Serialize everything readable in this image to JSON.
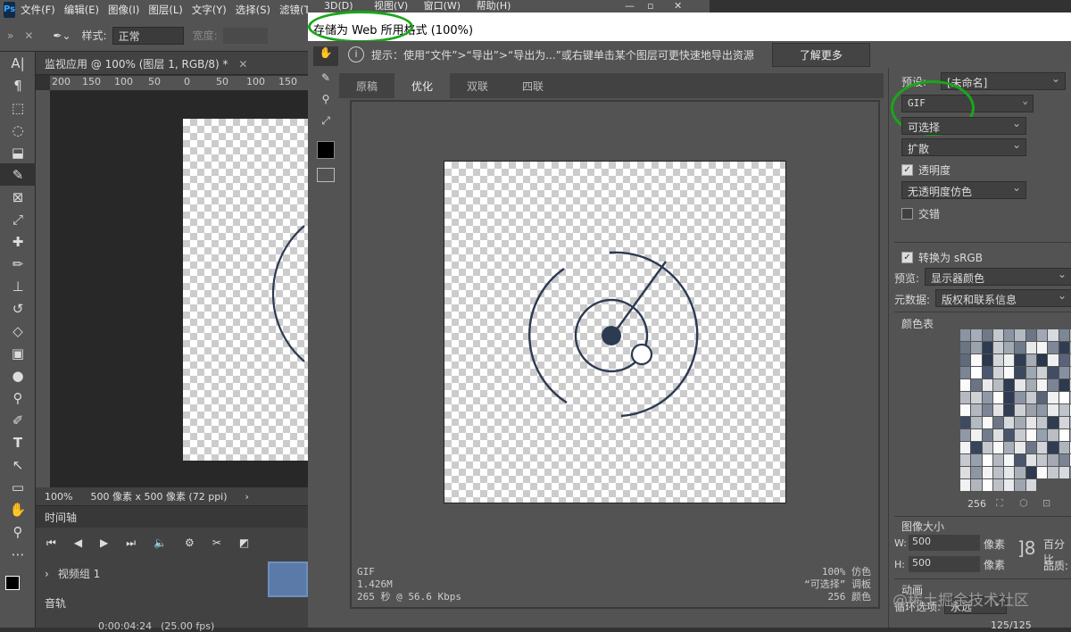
{
  "app": {
    "logo": "Ps",
    "menu": [
      "文件(F)",
      "编辑(E)",
      "图像(I)",
      "图层(L)",
      "文字(Y)",
      "选择(S)",
      "滤镜(T)",
      "3D(D)",
      "视图(V)",
      "窗口(W)",
      "帮助(H)"
    ]
  },
  "options": {
    "style_label": "样式:",
    "style_value": "正常",
    "width_label": "宽度:"
  },
  "document": {
    "tab_title": "监视应用 @ 100% (图层 1, RGB/8) *",
    "ruler_ticks": [
      "200",
      "150",
      "100",
      "50",
      "0",
      "50",
      "100",
      "150"
    ],
    "zoom": "100%",
    "size_info": "500 像素 x 500 像素 (72 ppi)"
  },
  "timeline": {
    "title": "时间轴",
    "video_group": "视频组 1",
    "audio": "音轨",
    "timecode": "0:00:04:24",
    "fps": "(25.00 fps)"
  },
  "dialog": {
    "title": "存储为 Web 所用格式 (100%)",
    "hint": "提示：使用“文件”>“导出”>“导出为...”或右键单击某个图层可更快速地导出资源",
    "learn_more": "了解更多",
    "tabs": [
      "原稿",
      "优化",
      "双联",
      "四联"
    ],
    "active_tab": "优化",
    "preview_info": {
      "format": "GIF",
      "size": "1.426M",
      "time": "265 秒 @ 56.6 Kbps",
      "dither": "100% 仿色",
      "palette": "“可选择” 调板",
      "colors": "256 颜色"
    }
  },
  "settings": {
    "preset_label": "预设:",
    "preset_value": "[未命名]",
    "format": "GIF",
    "reduction": "可选择",
    "dither": "扩散",
    "transparency": "透明度",
    "transparency_checked": true,
    "matte_dither": "无透明度仿色",
    "interlaced": "交错",
    "interlaced_checked": false,
    "convert_srgb": "转换为 sRGB",
    "convert_checked": true,
    "preview_label": "预览:",
    "preview_value": "显示器颜色",
    "metadata_label": "元数据:",
    "metadata_value": "版权和联系信息",
    "color_table_title": "颜色表",
    "color_count": "256",
    "image_size_title": "图像大小",
    "w_label": "W:",
    "w_value": "500",
    "h_label": "H:",
    "h_value": "500",
    "unit": "像素",
    "percent_label": "百分比",
    "quality_label": "品质:",
    "animation_title": "动画",
    "loop_label": "循环选项:",
    "loop_value": "永远",
    "frame_counter": "125/125"
  },
  "palette_colors": [
    "#8a95a3",
    "#a5adb8",
    "#6f7a88",
    "#c4c9cf",
    "#8a95a3",
    "#b3b9c1",
    "#6c7584",
    "#a0a8b3",
    "#d7dadf",
    "#7d8795",
    "#b7bcc3",
    "#6a7483",
    "#9ba2ac",
    "#2d3b50",
    "#c8cdd3",
    "#a1a9b3",
    "#6f7a8a",
    "#e6e8ea",
    "#f5f5f5",
    "#7f8898",
    "#2f3d54",
    "#b0b6be",
    "#5f6a7a",
    "#fafafa",
    "#2b384d",
    "#d3d6da",
    "#eef0f1",
    "#2f3c52",
    "#a5acb6",
    "#2a374c",
    "#eff0f2",
    "#59647a",
    "#c0c5cb",
    "#7c8595",
    "#ffffff",
    "#4c5870",
    "#d0d3d8",
    "#fafafa",
    "#3b4860",
    "#9ea6b0",
    "#cdd1d6",
    "#414d64",
    "#8790a0",
    "#c6cbd1",
    "#fafafa",
    "#6a7485",
    "#e8e9eb",
    "#b8bdc4",
    "#2e3b51",
    "#e4e6e9",
    "#a5acb5",
    "#f3f4f5",
    "#7b8494",
    "#2c394f",
    "#d9dbdf",
    "#b5bac2",
    "#cfd2d7",
    "#8f98a6",
    "#fcfcfc",
    "#2f3b52",
    "#8b94a2",
    "#c7cbd1",
    "#5a6579",
    "#f0f1f3",
    "#ffffff",
    "#aeb4bd",
    "#fafafa",
    "#b2b8c0",
    "#7b8595",
    "#e2e4e7",
    "#303d53",
    "#cdd0d5",
    "#9aa1ab",
    "#8f98a6",
    "#e8eaec",
    "#bfc4cb",
    "#ffffff",
    "#3d4a62",
    "#b4bac2",
    "#f8f8f9",
    "#6c7686",
    "#d6d9dd",
    "#a3aab4",
    "#e4e6e8",
    "#c1c6cc",
    "#2e3b51",
    "#d3d6da",
    "#b0b6bf",
    "#8f98a5",
    "#f1f2f4",
    "#727d8d",
    "#dddfe2",
    "#47546b",
    "#c8ccd2",
    "#fbfbfb",
    "#95a0b0",
    "#b9bec5",
    "#ffffff",
    "#9ba3ae",
    "#f2f3f4",
    "#37445b",
    "#c4c8ce",
    "#fafafa",
    "#a7aeb8",
    "#e7e9eb",
    "#6d7788",
    "#d1d4d8",
    "#2f3c52",
    "#afb5bd",
    "#fdfdfd",
    "#c6cad0",
    "#97a0ac",
    "#ffffff",
    "#b4b9c1",
    "#f6f7f8",
    "#4a566d",
    "#e0e2e5",
    "#c3c7cd",
    "#a2a9b3",
    "#7a8493",
    "#ffffff",
    "#dcdee1",
    "#8d96a3",
    "#f2f3f4",
    "#bcc1c8",
    "#e5e7e9",
    "#a8afb8",
    "#2d3a50",
    "#fbfbfb",
    "#c5c9cf",
    "#d8dadd",
    "#7f8897",
    "#f0f1f2",
    "#b1b6be",
    "#fefefe",
    "#bcc1c7",
    "#e9eaec",
    "#9ea5af",
    "#d5d8dc"
  ]
}
